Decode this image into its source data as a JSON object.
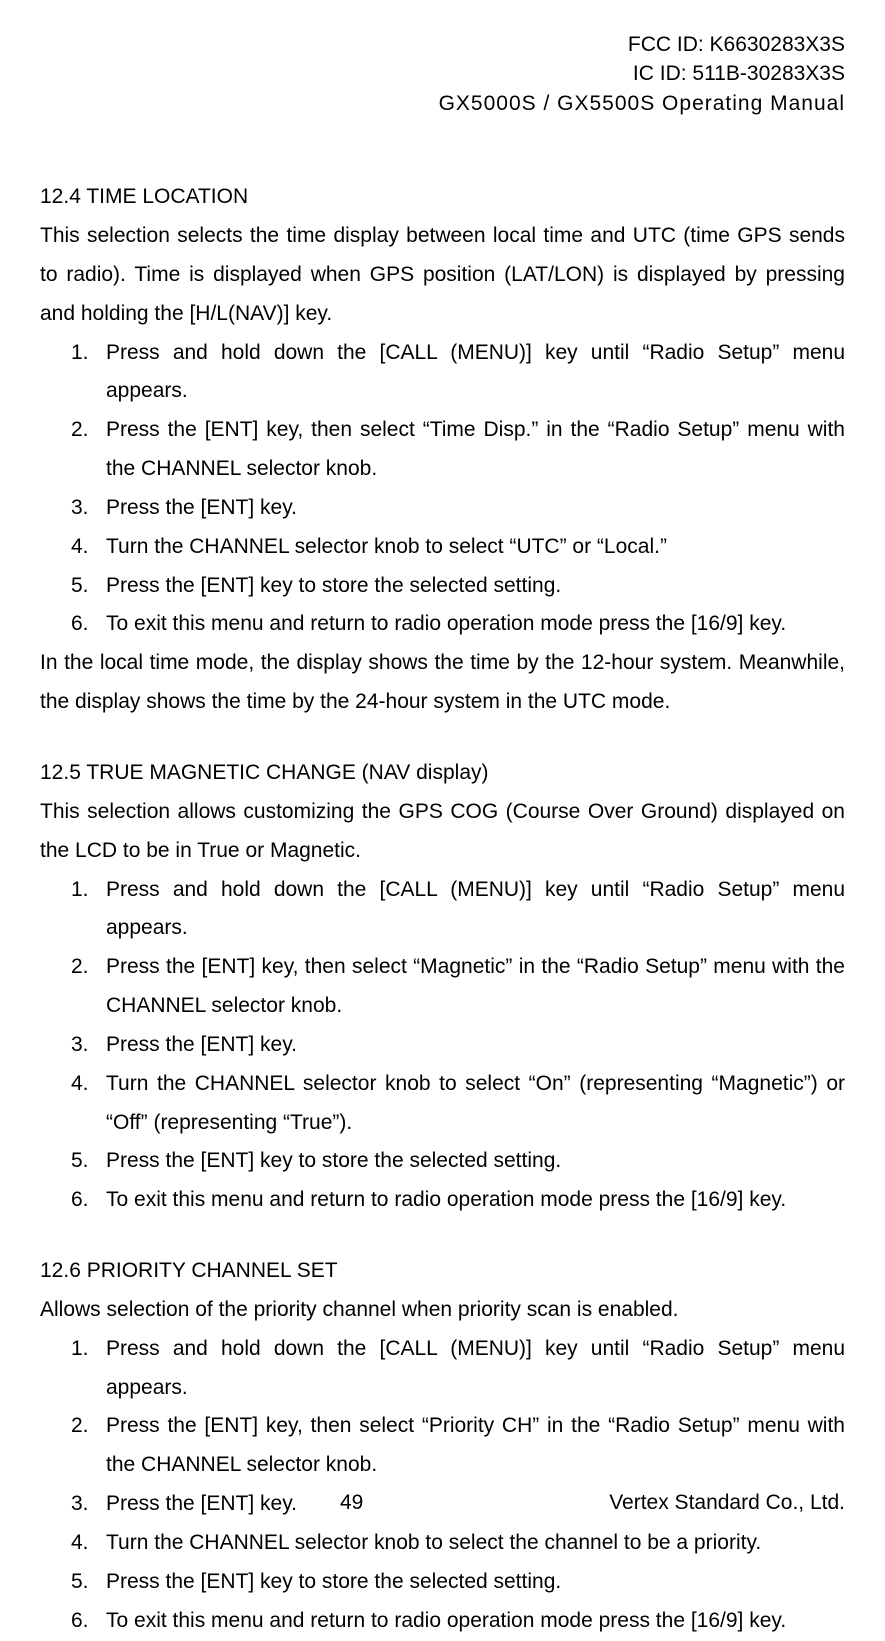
{
  "header": {
    "fcc": "FCC ID: K6630283X3S",
    "ic": "IC ID: 511B-30283X3S",
    "manual": "GX5000S / GX5500S  Operating Manual"
  },
  "sections": [
    {
      "heading": "12.4 TIME LOCATION",
      "intro": "This selection selects the time display between local time and UTC (time GPS sends to radio). Time is displayed when GPS position (LAT/LON) is displayed by pressing and holding the [H/L(NAV)] key.",
      "steps": [
        "Press and hold down the [CALL (MENU)] key until “Radio Setup” menu appears.",
        "Press the [ENT] key, then select “Time Disp.” in the “Radio Setup” menu with the CHANNEL selector knob.",
        "Press the [ENT] key.",
        "Turn the CHANNEL selector knob to select “UTC” or “Local.”",
        "Press the [ENT] key to store the selected setting.",
        "To exit this menu and return to radio operation mode press the [16/9] key."
      ],
      "after": "In the local time mode, the display shows the time by the 12-hour system. Meanwhile, the display shows the time by the 24-hour system in the UTC mode."
    },
    {
      "heading": "12.5 TRUE MAGNETIC CHANGE (NAV display)",
      "intro": "This selection allows customizing the GPS COG (Course Over Ground) displayed on the LCD to be in True or Magnetic.",
      "steps": [
        "Press and hold down the [CALL (MENU)] key until “Radio Setup” menu appears.",
        "Press the [ENT] key, then select “Magnetic” in the “Radio Setup” menu with the CHANNEL selector knob.",
        "Press the [ENT] key.",
        "Turn the CHANNEL selector knob to select “On” (representing “Magnetic”) or “Off” (representing “True”).",
        "Press the [ENT] key to store the selected setting.",
        "To exit this menu and return to radio operation mode press the [16/9] key."
      ],
      "after": ""
    },
    {
      "heading": "12.6 PRIORITY CHANNEL SET",
      "intro": "Allows selection of the priority channel when priority scan is enabled.",
      "steps": [
        "Press and hold down the [CALL (MENU)] key until “Radio Setup” menu appears.",
        "Press the [ENT] key, then select “Priority CH” in the “Radio Setup” menu with the CHANNEL selector knob.",
        "Press the [ENT] key.",
        "Turn the CHANNEL selector knob to select the channel to be a priority.",
        "Press the [ENT] key to store the selected setting.",
        "To exit this menu and return to radio operation mode press the [16/9] key."
      ],
      "after": ""
    }
  ],
  "footer": {
    "page_number": "49",
    "company": "Vertex Standard Co., Ltd."
  }
}
